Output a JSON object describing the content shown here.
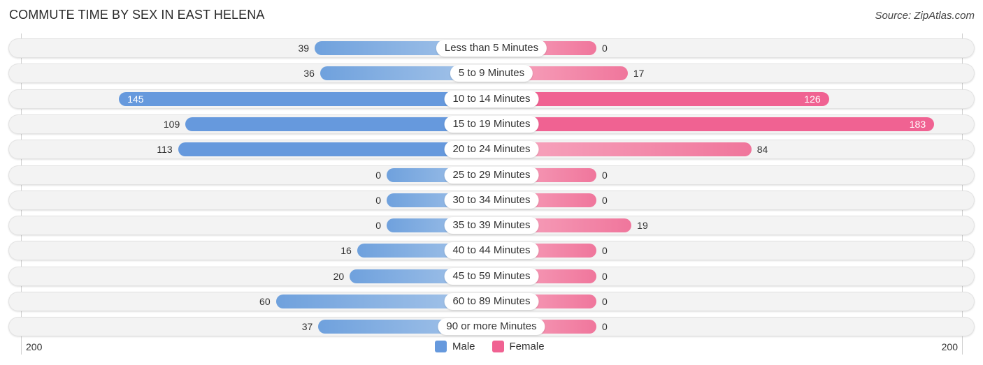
{
  "title": "COMMUTE TIME BY SEX IN EAST HELENA",
  "source": "Source: ZipAtlas.com",
  "chart_data": {
    "type": "bar",
    "orientation": "horizontal-diverging",
    "title": "COMMUTE TIME BY SEX IN EAST HELENA",
    "categories": [
      "Less than 5 Minutes",
      "5 to 9 Minutes",
      "10 to 14 Minutes",
      "15 to 19 Minutes",
      "20 to 24 Minutes",
      "25 to 29 Minutes",
      "30 to 34 Minutes",
      "35 to 39 Minutes",
      "40 to 44 Minutes",
      "45 to 59 Minutes",
      "60 to 89 Minutes",
      "90 or more Minutes"
    ],
    "series": [
      {
        "name": "Male",
        "color": "#6699dd",
        "values": [
          39,
          36,
          145,
          109,
          113,
          0,
          0,
          0,
          16,
          20,
          60,
          37
        ]
      },
      {
        "name": "Female",
        "color": "#f06292",
        "values": [
          0,
          17,
          126,
          183,
          84,
          0,
          0,
          19,
          0,
          0,
          0,
          0
        ]
      }
    ],
    "axis": {
      "left_tick": "200",
      "right_tick": "200",
      "range": [
        0,
        200
      ]
    },
    "legend": {
      "position": "bottom-center",
      "entries": [
        "Male",
        "Female"
      ]
    }
  }
}
